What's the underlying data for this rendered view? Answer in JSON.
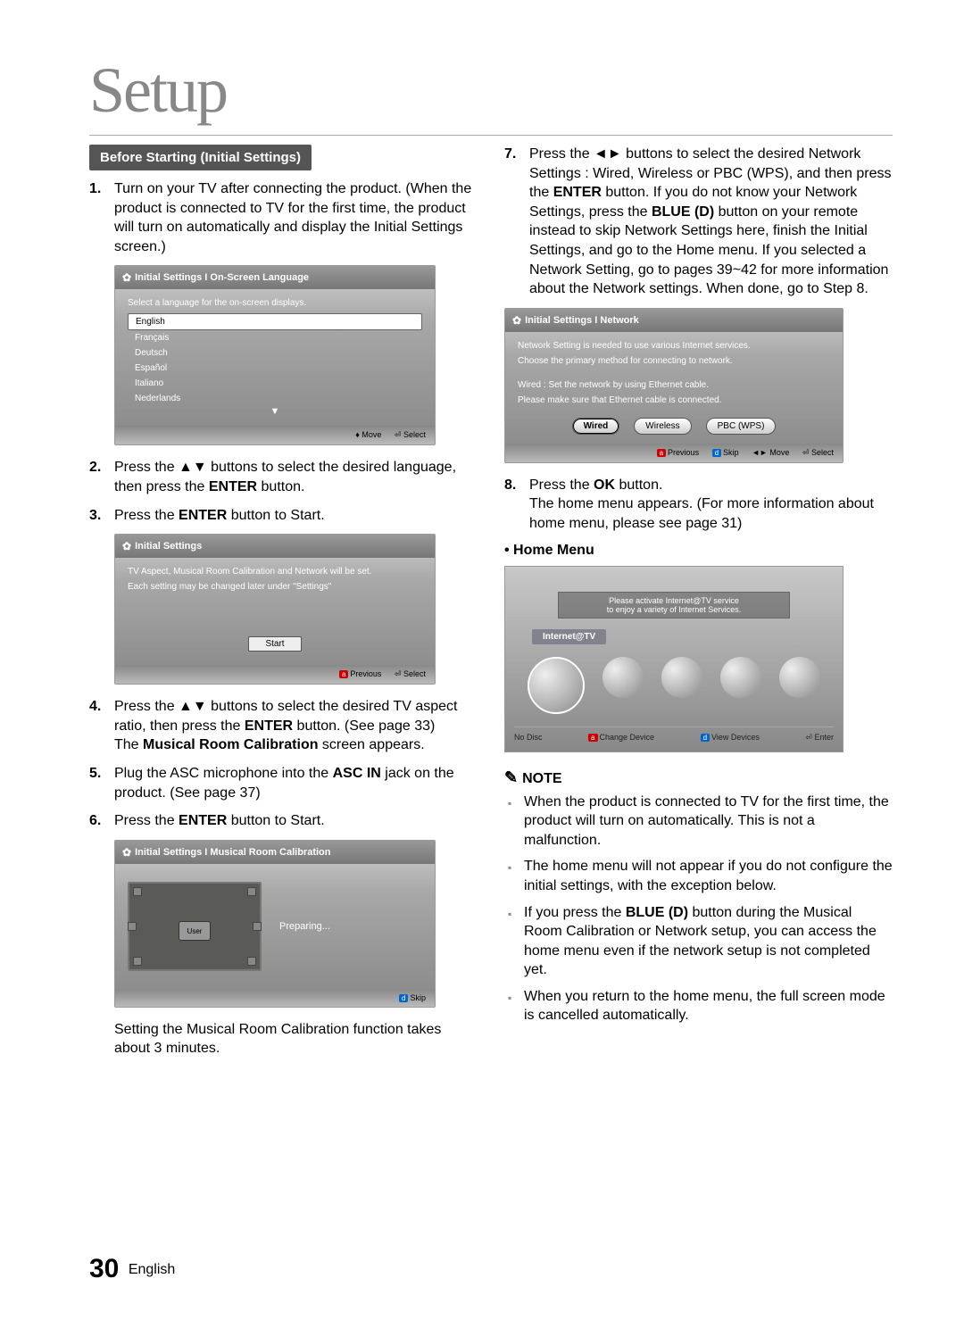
{
  "chapter": "Setup",
  "section_header": "Before Starting (Initial Settings)",
  "steps_left": {
    "s1": "Turn on your TV after connecting the product. (When the product is connected to TV for the first time, the product  will turn on automatically and display the Initial Settings screen.)",
    "s2a": "Press the ",
    "s2b": " buttons to select the desired language, then press the ",
    "s2c": " button.",
    "s3a": "Press the ",
    "s3b": " button to Start.",
    "s4a": "Press the ",
    "s4b": " buttons to select the desired TV aspect ratio, then press the ",
    "s4c": " button. (See page 33)",
    "s4d": "The ",
    "s4e": " screen appears.",
    "s5a": "Plug the ASC microphone into the ",
    "s5b": " jack on the product. (See page 37)",
    "s6a": "Press the ",
    "s6b": " button to Start.",
    "calib_caption": "Setting the Musical Room Calibration function takes about 3 minutes."
  },
  "labels": {
    "enter": "ENTER",
    "ok": "OK",
    "blue_d": "BLUE (D)",
    "asc_in": "ASC IN",
    "mrc": "Musical Room Calibration",
    "home_menu": "Home Menu",
    "note": "NOTE"
  },
  "ss_lang": {
    "title": "Initial Settings I On-Screen Language",
    "instruction": "Select a language for the on-screen displays.",
    "options": [
      "English",
      "Français",
      "Deutsch",
      "Español",
      "Italiano",
      "Nederlands"
    ],
    "footer_move": "Move",
    "footer_select": "Select"
  },
  "ss_start": {
    "title": "Initial Settings",
    "line1": "TV Aspect, Musical Room Calibration and Network will be set.",
    "line2": "Each setting may be changed later under \"Settings\"",
    "start": "Start",
    "footer_prev": "Previous",
    "footer_select": "Select"
  },
  "ss_calib": {
    "title": "Initial Settings I Musical Room Calibration",
    "user": "User",
    "status": "Preparing...",
    "footer_skip": "Skip"
  },
  "steps_right": {
    "s7a": "Press the ",
    "s7b": " buttons to select the desired Network Settings : Wired, Wireless or PBC (WPS), and then press the ",
    "s7c": " button. If you do not know your Network Settings, press the ",
    "s7d": " button on your remote instead to skip Network Settings here, finish the Initial Settings, and go to the Home menu. If you selected a Network Setting, go to pages 39~42 for more information about the Network settings. When done, go to Step 8.",
    "s8a": "Press the ",
    "s8b": " button.",
    "s8c": "The home menu appears. (For more information about home menu, please see page 31)"
  },
  "ss_network": {
    "title": "Initial Settings I Network",
    "line1": "Network Setting is needed to use various Internet services.",
    "line2": "Choose the primary method for connecting to network.",
    "line3": "Wired : Set the network by using Ethernet cable.",
    "line4": "Please make sure that Ethernet cable is connected.",
    "btn1": "Wired",
    "btn2": "Wireless",
    "btn3": "PBC (WPS)",
    "footer_prev": "Previous",
    "footer_skip": "Skip",
    "footer_move": "Move",
    "footer_select": "Select"
  },
  "ss_home": {
    "banner1": "Please activate Internet@TV service",
    "banner2": "to enjoy a variety of Internet Services.",
    "label": "Internet@TV",
    "footer_nodisc": "No Disc",
    "footer_change": "Change Device",
    "footer_view": "View Devices",
    "footer_enter": "Enter"
  },
  "notes": {
    "n1": "When the product is connected to TV for the first time, the product will turn on automatically. This is not a malfunction.",
    "n2": "The home menu will not appear if you do not configure the initial settings, with the exception below.",
    "n3a": "If you press the ",
    "n3b": " button during the Musical Room Calibration or Network setup, you can access the home menu even if the network setup is not completed yet.",
    "n4": "When you return to the home menu, the full screen mode is cancelled automatically."
  },
  "footer": {
    "page": "30",
    "lang": "English"
  }
}
